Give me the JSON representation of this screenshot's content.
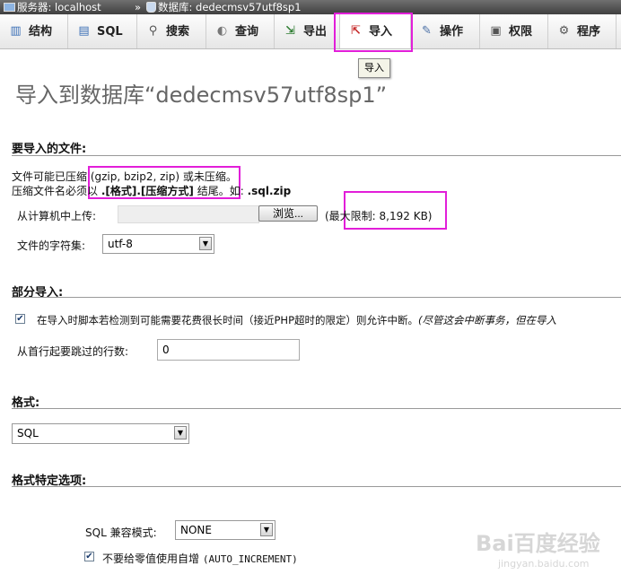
{
  "breadcrumb": {
    "server_label": "服务器:",
    "server_value": "localhost",
    "separator": "»",
    "db_label": "数据库:",
    "db_value": "dedecmsv57utf8sp1"
  },
  "tabs": [
    {
      "label": "结构",
      "icon": "structure-icon"
    },
    {
      "label": "SQL",
      "icon": "sql-icon"
    },
    {
      "label": "搜索",
      "icon": "search-icon"
    },
    {
      "label": "查询",
      "icon": "query-icon"
    },
    {
      "label": "导出",
      "icon": "export-icon"
    },
    {
      "label": "导入",
      "icon": "import-icon",
      "active": true
    },
    {
      "label": "操作",
      "icon": "wrench-icon"
    },
    {
      "label": "权限",
      "icon": "privileges-icon"
    },
    {
      "label": "程序",
      "icon": "routines-icon"
    }
  ],
  "tooltip": "导入",
  "page_title": "导入到数据库“dedecmsv57utf8sp1”",
  "file_section": {
    "title": "要导入的文件:",
    "compress_line1": "文件可能已压缩 (gzip, bzip2, zip) 或未压缩。",
    "compress_line2_prefix": "压缩文件名必须以",
    "compress_line2_bold": ".[格式].[压缩方式]",
    "compress_line2_mid": "结尾。如:",
    "compress_line2_example": ".sql.zip",
    "upload_label": "从计算机中上传:",
    "browse_button": "浏览...",
    "max_limit": "(最大限制: 8,192 KB)",
    "charset_label": "文件的字符集:",
    "charset_value": "utf-8"
  },
  "partial_section": {
    "title": "部分导入:",
    "interrupt_checked": true,
    "interrupt_text": "在导入时脚本若检测到可能需要花费很长时间（接近PHP超时的限定）则允许中断。",
    "interrupt_note": "(尽管这会中断事务，但在导入",
    "skip_label": "从首行起要跳过的行数:",
    "skip_value": "0"
  },
  "format_section": {
    "title": "格式:",
    "format_value": "SQL"
  },
  "format_options_section": {
    "title": "格式特定选项:",
    "compat_label": "SQL 兼容模式:",
    "compat_value": "NONE",
    "auto_inc_checked": true,
    "auto_inc_text": "不要给零值使用自增",
    "auto_inc_code": "(AUTO_INCREMENT)"
  },
  "watermark": {
    "brand": "Bai百度经验",
    "url": "jingyan.baidu.com"
  },
  "colors": {
    "highlight": "#e21ed9",
    "title_gray": "#666666"
  }
}
